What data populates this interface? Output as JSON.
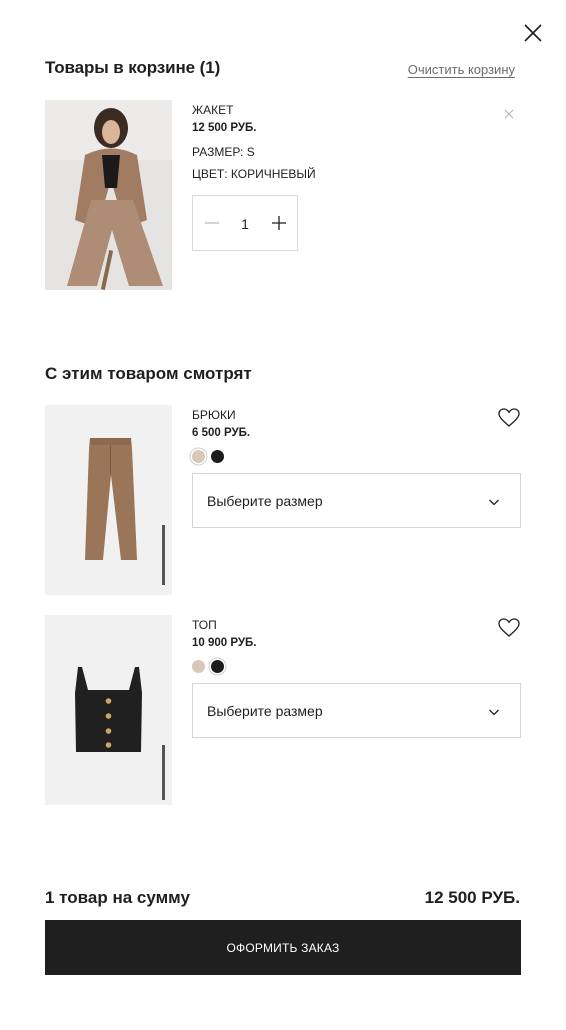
{
  "header": {
    "title": "Товары в корзине (1)",
    "clear_label": "Очистить корзину"
  },
  "cart": {
    "items": [
      {
        "name": "ЖАКЕТ",
        "price": "12 500 РУБ.",
        "size": "РАЗМЕР: S",
        "color": "ЦВЕТ: КОРИЧНЕВЫЙ",
        "quantity": "1"
      }
    ]
  },
  "recommendations": {
    "title": "С этим товаром смотрят",
    "items": [
      {
        "name": "БРЮКИ",
        "price": "6 500 РУБ.",
        "size_placeholder": "Выберите размер",
        "colors": [
          "#d9c8b8",
          "#1c1c1c"
        ]
      },
      {
        "name": "ТОП",
        "price": "10 900 РУБ.",
        "size_placeholder": "Выберите размер",
        "colors": [
          "#d9c8b8",
          "#1c1c1c"
        ]
      }
    ]
  },
  "summary": {
    "label": "1 товар на сумму",
    "total": "12 500 РУБ."
  },
  "checkout_label": "ОФОРМИТЬ ЗАКАЗ",
  "colors": {
    "accent": "#1f1f1f",
    "border": "#d4d4d4"
  }
}
